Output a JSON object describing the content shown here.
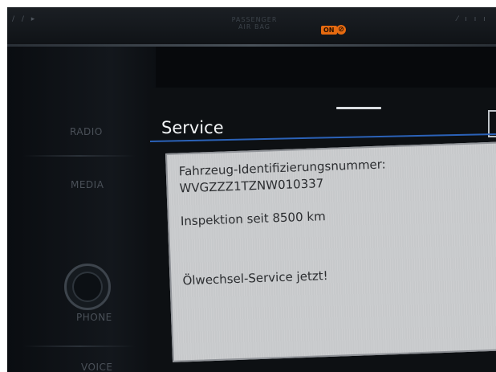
{
  "top_bar": {
    "passenger_airbag_line1": "PASSENGER",
    "passenger_airbag_line2": "AIR BAG",
    "airbag_on_label": "ON",
    "airbag_off_icon": "airbag-off-icon"
  },
  "side_buttons": [
    {
      "label": "RADIO"
    },
    {
      "label": "MEDIA"
    },
    {
      "label": "PHONE"
    },
    {
      "label": "VOICE"
    }
  ],
  "screen": {
    "title": "Service",
    "vin_label": "Fahrzeug-Identifizierungsnummer:",
    "vin_value": "WVGZZZ1TZNW010337",
    "inspection": "Inspektion seit 8500 km",
    "oil_service": "Ölwechsel-Service jetzt!"
  },
  "colors": {
    "accent_line": "#2b62b8",
    "airbag_indicator": "#e66a10",
    "panel_bg": "#c7c9cb"
  }
}
